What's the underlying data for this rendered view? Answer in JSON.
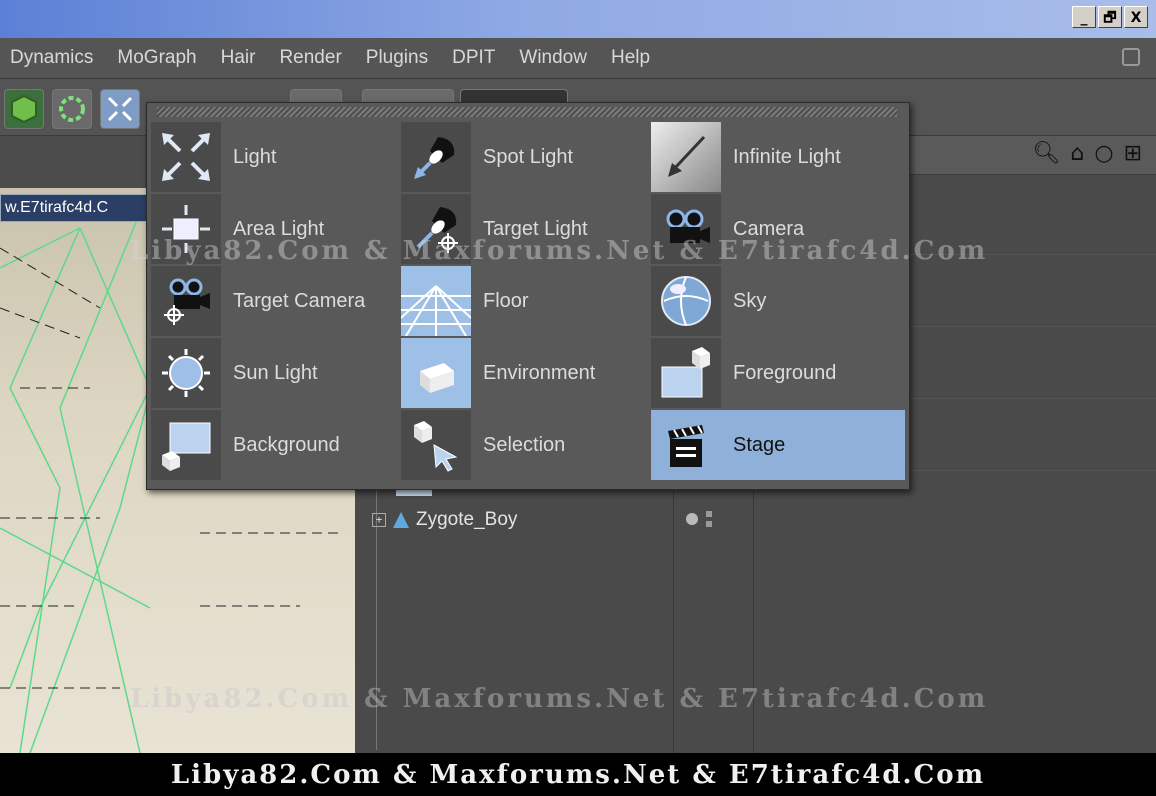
{
  "window": {
    "buttons": [
      "_",
      "🗗",
      "X"
    ]
  },
  "menubar": {
    "items": [
      "Dynamics",
      "MoGraph",
      "Hair",
      "Render",
      "Plugins",
      "DPIT",
      "Window",
      "Help"
    ]
  },
  "viewport": {
    "label": "w.E7tirafc4d.C"
  },
  "object_manager": {
    "objects": [
      {
        "name": "Zygote_Boy",
        "expander": "+"
      }
    ]
  },
  "popup_menu": {
    "items": [
      {
        "label": "Light",
        "icon": "light-icon"
      },
      {
        "label": "Spot Light",
        "icon": "spot-light-icon"
      },
      {
        "label": "Infinite Light",
        "icon": "infinite-light-icon"
      },
      {
        "label": "Area Light",
        "icon": "area-light-icon"
      },
      {
        "label": "Target Light",
        "icon": "target-light-icon"
      },
      {
        "label": "Camera",
        "icon": "camera-icon"
      },
      {
        "label": "Target Camera",
        "icon": "target-camera-icon"
      },
      {
        "label": "Floor",
        "icon": "floor-icon"
      },
      {
        "label": "Sky",
        "icon": "sky-icon"
      },
      {
        "label": "Sun Light",
        "icon": "sun-light-icon"
      },
      {
        "label": "Environment",
        "icon": "environment-icon"
      },
      {
        "label": "Foreground",
        "icon": "foreground-icon"
      },
      {
        "label": "Background",
        "icon": "background-icon"
      },
      {
        "label": "Selection",
        "icon": "selection-icon"
      },
      {
        "label": "Stage",
        "icon": "stage-icon",
        "selected": true
      }
    ]
  },
  "watermark": {
    "text": "Libya82.Com & Maxforums.Net & E7tirafc4d.Com"
  },
  "colors": {
    "selected_bg": "#8fb1d9",
    "titlebar": "#5c80d6",
    "panel": "#4a4a4a"
  }
}
